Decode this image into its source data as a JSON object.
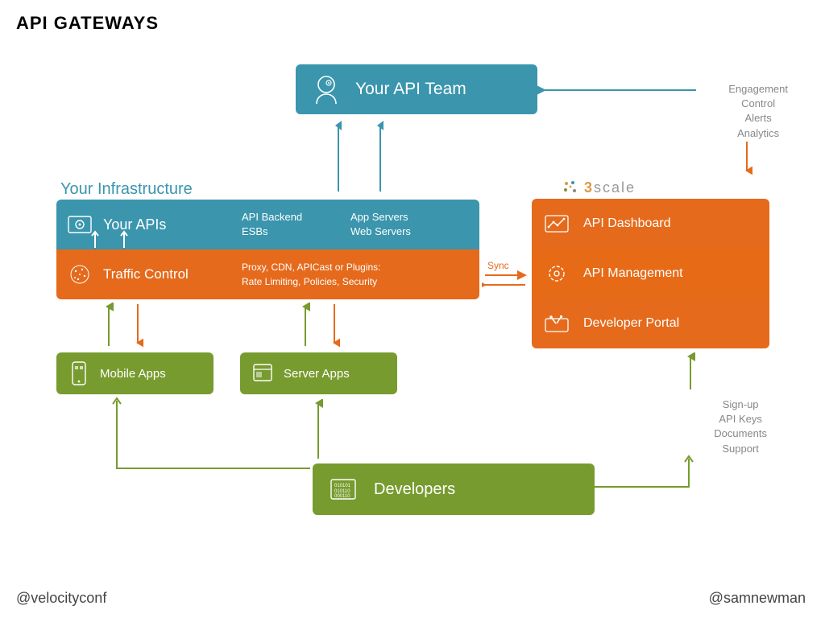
{
  "title": "API GATEWAYS",
  "team": {
    "label": "Your API Team"
  },
  "infra": {
    "label": "Your Infrastructure",
    "apis": {
      "title": "Your APIs",
      "col1a": "API Backend",
      "col1b": "ESBs",
      "col2a": "App Servers",
      "col2b": "Web Servers"
    },
    "traffic": {
      "title": "Traffic Control",
      "line1": "Proxy, CDN, APICast or Plugins:",
      "line2": "Rate Limiting, Policies, Security"
    }
  },
  "sync_label": "Sync",
  "scale": {
    "brand": "3scale",
    "rows": [
      {
        "label": "API Dashboard"
      },
      {
        "label": "API Management"
      },
      {
        "label": "Developer Portal"
      }
    ]
  },
  "apps": {
    "mobile": "Mobile Apps",
    "server": "Server Apps"
  },
  "developers": {
    "label": "Developers"
  },
  "annotations": {
    "engagement": [
      "Engagement",
      "Control",
      "Alerts",
      "Analytics"
    ],
    "signup": [
      "Sign-up",
      "API Keys",
      "Documents",
      "Support"
    ]
  },
  "footer": {
    "left": "@velocityconf",
    "right": "@samnewman"
  },
  "colors": {
    "teal": "#3a95ad",
    "orange": "#e56a1c",
    "green": "#779b2e",
    "grey": "#888"
  }
}
